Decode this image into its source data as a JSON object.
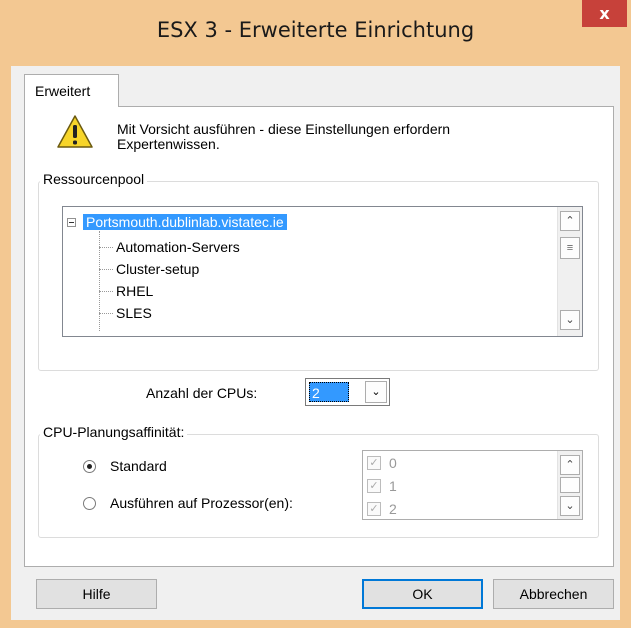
{
  "window": {
    "title": "ESX 3 - Erweiterte Einrichtung",
    "close_glyph": "x"
  },
  "tab": {
    "label": "Erweitert"
  },
  "warning": {
    "icon": "warning-icon",
    "text_line1": "Mit Vorsicht ausführen - diese Einstellungen erfordern",
    "text_line2": "Expertenwissen."
  },
  "resource_pool": {
    "label": "Ressourcenpool",
    "root": "Portsmouth.dublinlab.vistatec.ie",
    "children": [
      "Automation-Servers",
      "Cluster-setup",
      "RHEL",
      "SLES"
    ]
  },
  "cpus": {
    "label": "Anzahl der CPUs:",
    "value": "2"
  },
  "affinity": {
    "label": "CPU-Planungsaffinität:",
    "option_standard": "Standard",
    "option_processor": "Ausführen auf Prozessor(en):",
    "selected": "Standard",
    "processors": [
      "0",
      "1",
      "2"
    ]
  },
  "buttons": {
    "help": "Hilfe",
    "ok": "OK",
    "cancel": "Abbrechen"
  },
  "colors": {
    "frame": "#f3c892",
    "close": "#c7413a",
    "selection": "#3399ff"
  }
}
